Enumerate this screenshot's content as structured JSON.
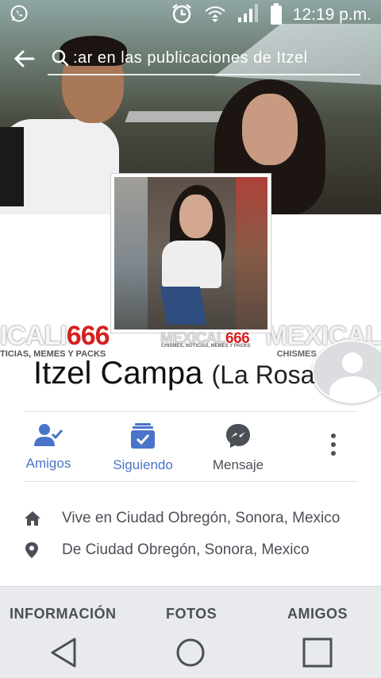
{
  "status_bar": {
    "time": "12:19 p.m.",
    "icons": [
      "whatsapp-icon",
      "alarm-icon",
      "data-transfer-icon",
      "signal-icon",
      "battery-icon"
    ]
  },
  "search": {
    "text": ":ar en las publicaciones de Itzel"
  },
  "profile": {
    "name": "Itzel Campa",
    "nickname": "(La Rosa"
  },
  "watermark": {
    "brand_part1": "MEXICAL",
    "brand_part2": "666",
    "tagline": "CHISMES, NOTICIAS, MEMES Y PACKS",
    "left_part1": "ICALI",
    "left_part2": "666",
    "left_tagline": "TICIAS, MEMES Y PACKS",
    "right_text": "MEXICAL",
    "right_tagline": "CHISMES, NOTICIAS, ME"
  },
  "actions": [
    {
      "label": "Amigos",
      "icon": "friends-check-icon",
      "color": "#4a74c9"
    },
    {
      "label": "Siguiendo",
      "icon": "following-check-icon",
      "color": "#4a74c9"
    },
    {
      "label": "Mensaje",
      "icon": "messenger-icon",
      "color": "#4b4f56"
    }
  ],
  "info": {
    "lives_in": "Vive en Ciudad Obregón, Sonora, Mexico",
    "from": "De Ciudad Obregón, Sonora, Mexico"
  },
  "tabs": [
    {
      "label": "INFORMACIÓN"
    },
    {
      "label": "FOTOS"
    },
    {
      "label": "AMIGOS"
    }
  ],
  "colors": {
    "facebook_blue": "#4a74c9",
    "secondary_text": "#4b4f56",
    "watermark_red": "#d6201f"
  }
}
